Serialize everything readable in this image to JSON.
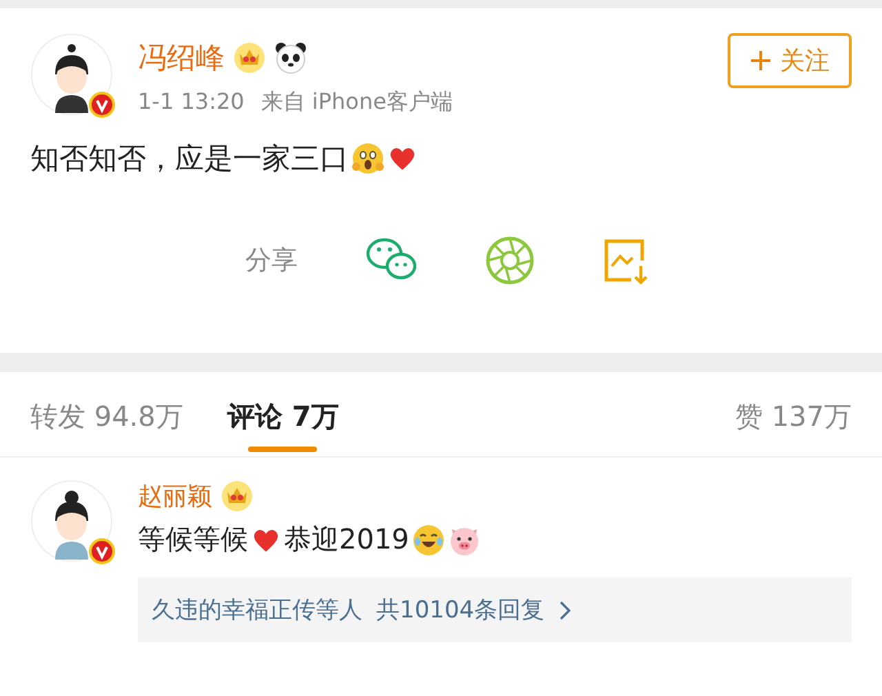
{
  "post": {
    "author": "冯绍峰",
    "time": "1-1 13:20",
    "source": "来自 iPhone客户端",
    "follow_button": "关注",
    "text": "知否知否，应是一家三口"
  },
  "share": {
    "label": "分享"
  },
  "tabs": [
    {
      "label": "转发 94.8万",
      "selected": false
    },
    {
      "label": "评论 7万",
      "selected": true
    },
    {
      "label": "赞 137万",
      "selected": false
    }
  ],
  "comments": [
    {
      "author": "赵丽颖",
      "text": "等候等候",
      "text_2": "恭迎2019",
      "replies": "久违的幸福正传等人",
      "reply_count": "共10104条回复"
    }
  ]
}
